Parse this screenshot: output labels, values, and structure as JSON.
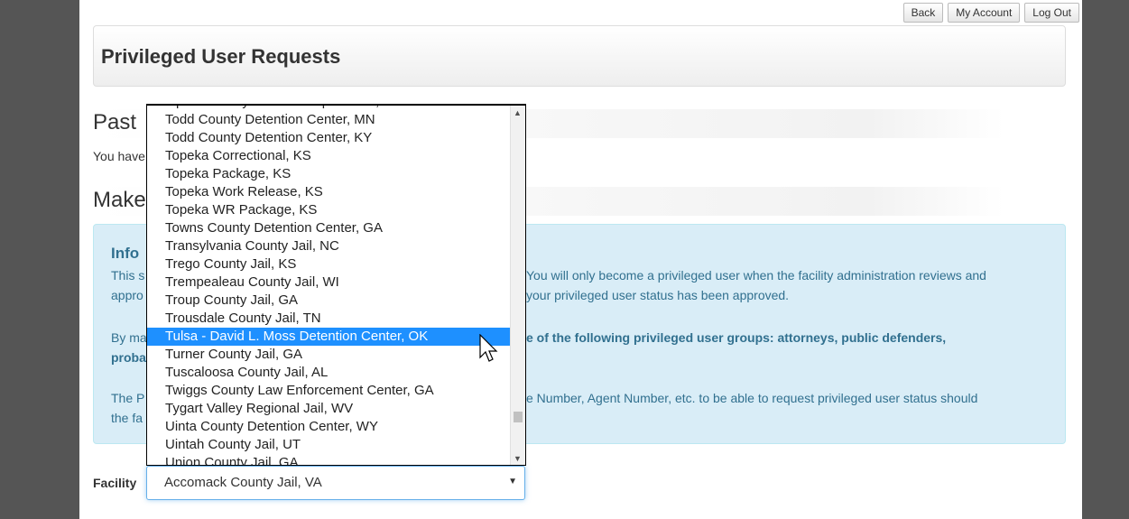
{
  "top_buttons": [
    "Back",
    "My Account",
    "Log Out"
  ],
  "header": {
    "title": "Privileged User Requests"
  },
  "past": {
    "heading": "Past",
    "text": "You have"
  },
  "make": {
    "heading": "Make"
  },
  "info": {
    "title": "Info",
    "line1_left": "This s",
    "line1_right": "You will only become a privileged user when the facility administration reviews and",
    "line2_left": "appro",
    "line2_right": "your privileged user status has been approved.",
    "line3_left": "By ma",
    "line3_right": "e of the following privileged user groups: attorneys, public defenders,",
    "line4_left": "proba",
    "line5_left": "The P",
    "line5_right": "e Number, Agent Number, etc. to be able to request privileged user status should",
    "line6_left": "the fa"
  },
  "facility": {
    "label": "Facility",
    "selected_value": "Accomack County Jail, VA"
  },
  "dropdown": {
    "options": [
      "Tipton County Sheriff's Department, TN",
      "Todd County Detention Center, MN",
      "Todd County Detention Center, KY",
      "Topeka Correctional, KS",
      "Topeka Package, KS",
      "Topeka Work Release, KS",
      "Topeka WR Package, KS",
      "Towns County Detention Center, GA",
      "Transylvania County Jail, NC",
      "Trego County Jail, KS",
      "Trempealeau County Jail, WI",
      "Troup County Jail, GA",
      "Trousdale County Jail, TN",
      "Tulsa - David L. Moss Detention Center, OK",
      "Turner County Jail, GA",
      "Tuscaloosa County Jail, AL",
      "Twiggs County Law Enforcement Center, GA",
      "Tygart Valley Regional Jail, WV",
      "Uinta County Detention Center, WY",
      "Uintah County Jail, UT",
      "Union County Jail, GA"
    ],
    "highlighted": "Tulsa - David L. Moss Detention Center, OK"
  }
}
